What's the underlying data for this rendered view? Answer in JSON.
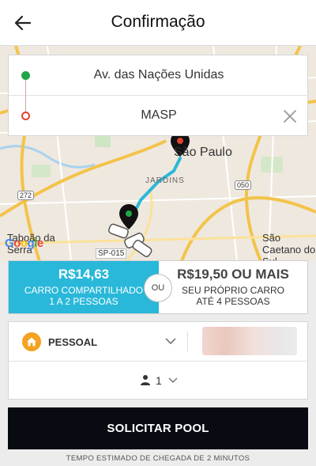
{
  "header": {
    "title": "Confirmação",
    "back_icon": "arrow-left-icon"
  },
  "route": {
    "pickup": "Av. das Nações Unidas",
    "destination": "MASP",
    "pickup_dot_color": "#1fa64a",
    "destination_dot_color": "#e0432f"
  },
  "map": {
    "labels": {
      "city": "São Paulo",
      "district": "JARDINS",
      "west_town": "Taboão da Serra",
      "east_town": "São Caetano do Sul",
      "highway": "SP-015",
      "shield_west": "272",
      "shield_east": "050"
    },
    "provider_logo": [
      "G",
      "o",
      "o",
      "g",
      "l",
      "e"
    ],
    "route_color": "#29b8d9"
  },
  "ride_options": {
    "pool": {
      "price": "R$14,63",
      "line1": "CARRO COMPARTILHADO",
      "line2": "1 A 2 PESSOAS",
      "color": "#29b8d9"
    },
    "separator": "OU",
    "x": {
      "price": "R$19,50 OU MAIS",
      "line1": "SEU PRÓPRIO CARRO",
      "line2": "ATÉ 4 PESSOAS"
    }
  },
  "payment": {
    "profile": "PESSOAL",
    "profile_icon": "home-icon",
    "profile_icon_color": "#f4a21f",
    "seats": "1",
    "seat_icon": "person-icon"
  },
  "action": {
    "request_label": "SOLICITAR POOL"
  },
  "footer": {
    "eta": "TEMPO ESTIMADO DE CHEGADA DE 2 MINUTOS"
  }
}
